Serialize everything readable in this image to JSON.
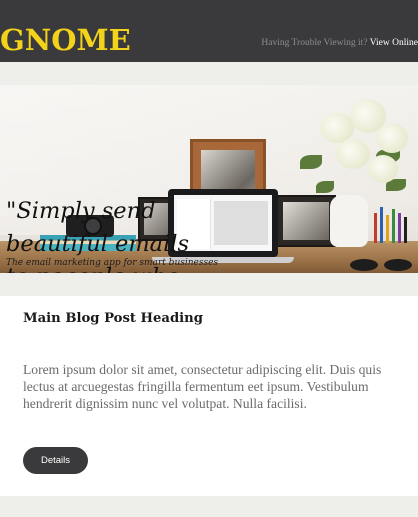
{
  "header": {
    "brand": "GNOME",
    "help_text": "Having Trouble Viewing it?",
    "view_online_label": "View Online"
  },
  "hero": {
    "quote": "\"Simply send\nbeautiful emails\nto peaople who\nmatter",
    "tagline": "The email marketing app for smart businesses"
  },
  "post": {
    "heading": "Main Blog Post Heading",
    "body": "Lorem ipsum dolor sit amet, consectetur adipiscing elit. Duis quis lectus at arcuegestas fringilla fermentum eet ipsum. Vestibulum hendrerit dignissim nunc vel volutpat. Nulla facilisi.",
    "details_label": "Details"
  },
  "colors": {
    "header_bg": "#3a3a3c",
    "brand": "#f2d21b",
    "band": "#eeeeea",
    "button_bg": "#3a3a3c"
  }
}
